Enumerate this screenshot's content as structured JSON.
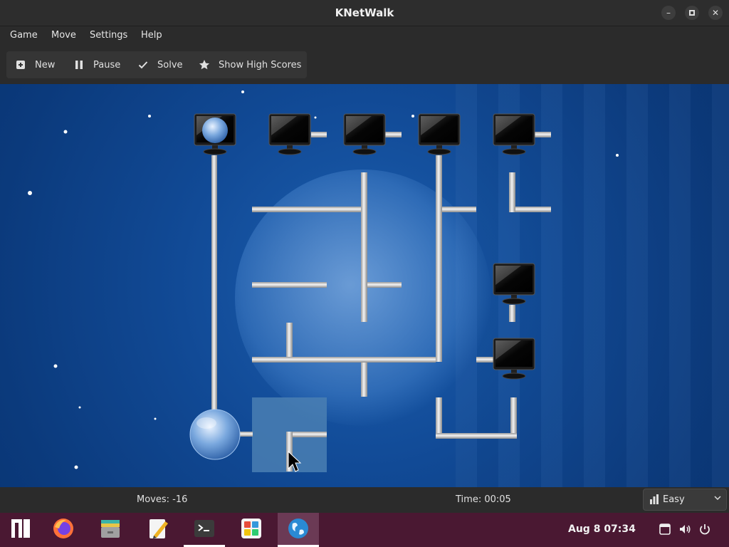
{
  "window": {
    "title": "KNetWalk",
    "controls": {
      "minimize": "–",
      "maximize": "▫",
      "close": "✕"
    }
  },
  "menu": [
    "Game",
    "Move",
    "Settings",
    "Help"
  ],
  "toolbar": {
    "new_label": "New",
    "pause_label": "Pause",
    "solve_label": "Solve",
    "highscores_label": "Show High Scores",
    "icons": [
      "new-document-icon",
      "pause-icon",
      "checkmark-icon",
      "star-icon"
    ]
  },
  "board": {
    "description_icons": [
      "server-globe-icon",
      "computer-monitor-icon",
      "pipe-segment"
    ],
    "colors": {
      "background": "#0b3a7c",
      "pipe": "#d9d9d9",
      "highlight_tile": "#4a7fb3"
    }
  },
  "status": {
    "moves": "Moves: -16",
    "time": "Time: 00:05",
    "difficulty": "Easy"
  },
  "taskbar": {
    "apps": [
      "manjaro-menu-icon",
      "firefox-icon",
      "files-icon",
      "text-editor-icon",
      "terminal-icon",
      "software-store-icon",
      "knetwalk-icon"
    ],
    "clock": "Aug 8  07:34",
    "tray_icons": [
      "clipboard-icon",
      "volume-icon",
      "power-icon"
    ],
    "colors": {
      "background": "#4a1832",
      "active": "#6b3a55"
    }
  }
}
